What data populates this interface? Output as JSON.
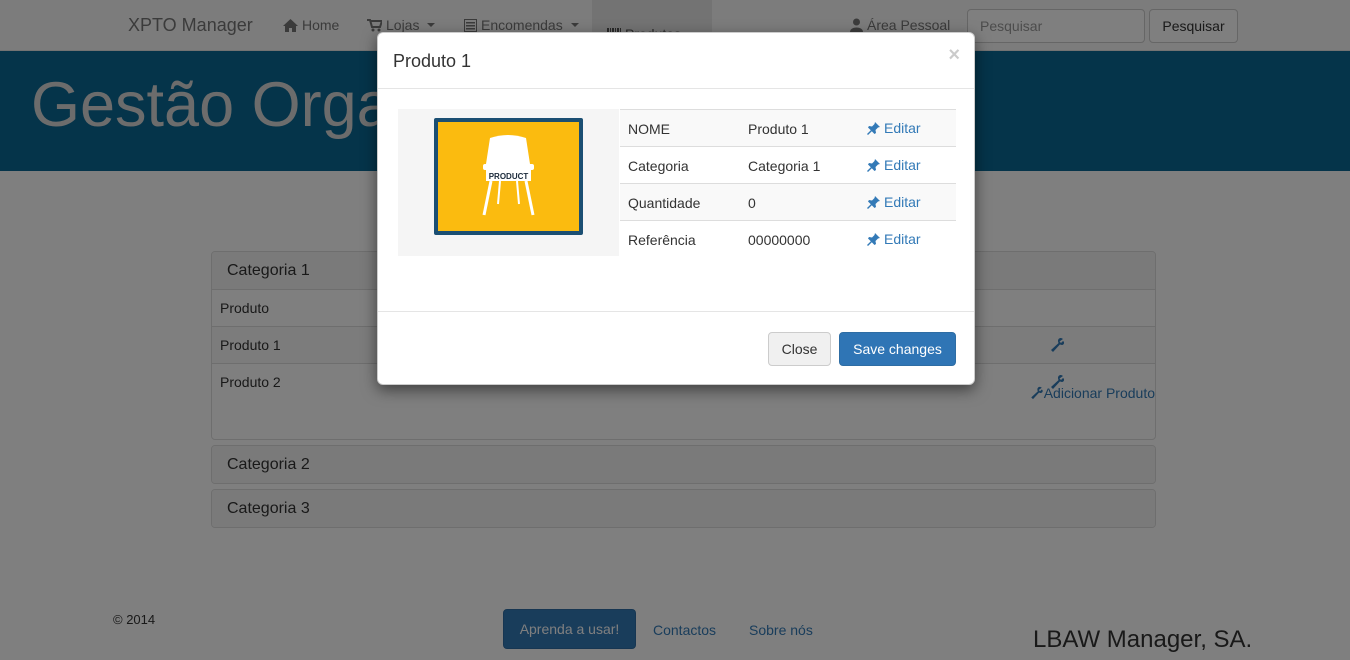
{
  "navbar": {
    "brand": "XPTO Manager",
    "items": [
      {
        "label": "Home",
        "icon": "home-icon"
      },
      {
        "label": "Lojas",
        "icon": "cart-icon"
      },
      {
        "label": "Encomendas",
        "icon": "list-icon"
      },
      {
        "label": "Produtos",
        "icon": "barcode-icon"
      }
    ],
    "personal": "Área Pessoal",
    "search_placeholder": "Pesquisar",
    "search_button": "Pesquisar"
  },
  "hero": {
    "title": "Gestão Organizada e Rápida"
  },
  "categories": [
    {
      "title": "Categoria 1",
      "column_header": "Produto",
      "products": [
        "Produto 1",
        "Produto 2"
      ],
      "add_label": "Adicionar Produto"
    },
    {
      "title": "Categoria 2"
    },
    {
      "title": "Categoria 3"
    }
  ],
  "footer": {
    "copyright": "© 2014",
    "learn_button": "Aprenda a usar!",
    "contacts": "Contactos",
    "about": "Sobre nós",
    "company": "LBAW Manager, SA."
  },
  "modal": {
    "title": "Produto 1",
    "close_symbol": "×",
    "image_label": "PRODUCT",
    "rows": [
      {
        "key": "NOME",
        "value": "Produto 1",
        "action": "Editar"
      },
      {
        "key": "Categoria",
        "value": "Categoria 1",
        "action": "Editar"
      },
      {
        "key": "Quantidade",
        "value": "0",
        "action": "Editar"
      },
      {
        "key": "Referência",
        "value": "00000000",
        "action": "Editar"
      }
    ],
    "close_button": "Close",
    "save_button": "Save changes"
  },
  "colors": {
    "primary": "#337ab7",
    "hero": "#0a6894",
    "product_bg": "#fbbb0f",
    "product_border": "#1b4f73"
  }
}
